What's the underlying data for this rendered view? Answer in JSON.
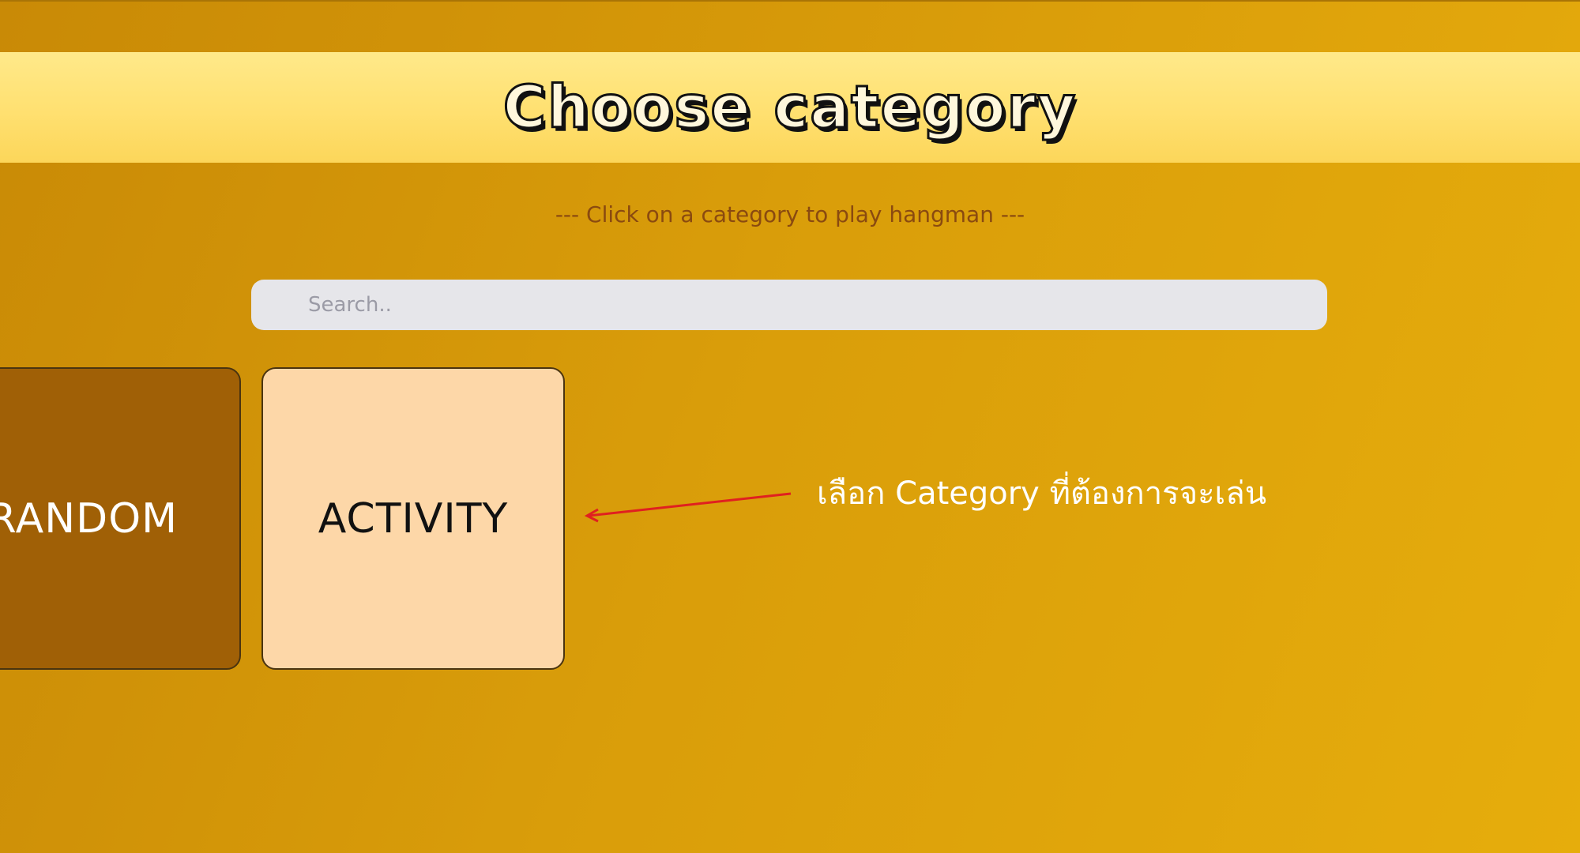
{
  "header": {
    "title": "Choose category"
  },
  "subtitle": "--- Click on a category to play hangman ---",
  "search": {
    "placeholder": "Search.."
  },
  "categories": [
    {
      "label": "RANDOM",
      "color": "#a06006"
    },
    {
      "label": "ACTIVITY",
      "color": "#fdd7a8"
    }
  ],
  "annotation": {
    "text": "เลือก Category ที่ต้องการจะเล่น",
    "arrow_color": "#e02020"
  },
  "colors": {
    "background": "#d99d0a",
    "banner": "#ffe070",
    "subtitle": "#8a4a10",
    "search_bg": "#e6e6ea"
  }
}
